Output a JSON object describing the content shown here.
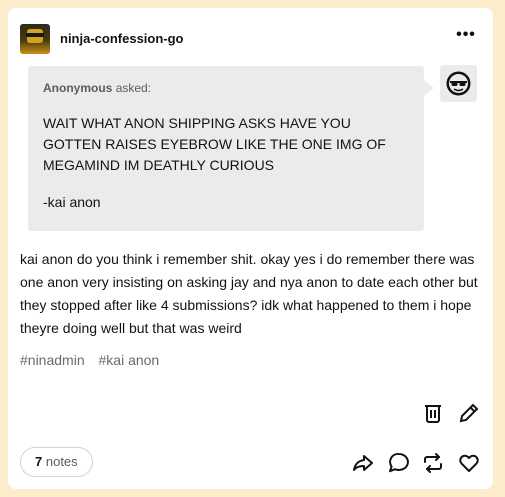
{
  "post": {
    "blog_name": "ninja-confession-go",
    "more_label": "•••",
    "ask": {
      "asker_name": "Anonymous",
      "asker_suffix": "asked:",
      "question": "WAIT WHAT ANON SHIPPING ASKS HAVE YOU GOTTEN RAISES EYEBROW LIKE THE ONE IMG OF MEGAMIND IM DEATHLY CURIOUS",
      "signoff": "-kai anon"
    },
    "answer": "kai anon do you think i remember shit. okay yes i do remember there was one anon very insisting on asking jay and nya anon to date each other but they stopped after like 4 submissions? idk what happened to them i hope theyre doing well but that was weird",
    "tags": [
      "#ninadmin",
      "#kai anon"
    ],
    "notes": {
      "count": "7",
      "label": "notes"
    }
  },
  "icons": {
    "more": "more-dots-icon",
    "delete": "trash-icon",
    "edit": "pencil-icon",
    "share": "share-icon",
    "reply": "reply-bubble-icon",
    "reblog": "reblog-icon",
    "like": "heart-icon"
  },
  "colors": {
    "background": "#fbeccc",
    "card": "#ffffff",
    "bubble": "#ebebeb"
  }
}
